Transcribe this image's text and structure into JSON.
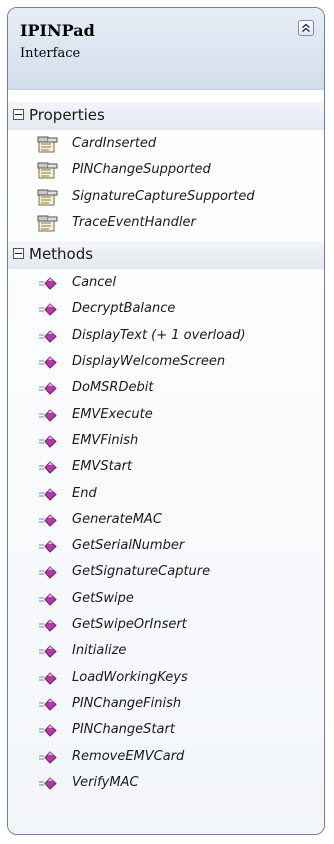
{
  "class_box": {
    "name": "IPINPad",
    "stereotype": "Interface",
    "collapse_icon": "double-chevron-up-icon"
  },
  "sections": {
    "properties": {
      "label": "Properties",
      "toggle_icon": "collapse-minus-icon",
      "member_icon": "property-icon",
      "items": [
        "CardInserted",
        "PINChangeSupported",
        "SignatureCaptureSupported",
        "TraceEventHandler"
      ]
    },
    "methods": {
      "label": "Methods",
      "toggle_icon": "collapse-minus-icon",
      "member_icon": "method-icon",
      "items": [
        "Cancel",
        "DecryptBalance",
        "DisplayText (+ 1 overload)",
        "DisplayWelcomeScreen",
        "DoMSRDebit",
        "EMVExecute",
        "EMVFinish",
        "EMVStart",
        "End",
        "GenerateMAC",
        "GetSerialNumber",
        "GetSignatureCapture",
        "GetSwipe",
        "GetSwipeOrInsert",
        "Initialize",
        "LoadWorkingKeys",
        "PINChangeFinish",
        "PINChangeStart",
        "RemoveEMVCard",
        "VerifyMAC"
      ]
    }
  },
  "colors": {
    "border": "#6d7f9a",
    "header_bg": "#dbe4f0",
    "method_icon": "#b03ca8",
    "text": "#1a1a1a"
  }
}
